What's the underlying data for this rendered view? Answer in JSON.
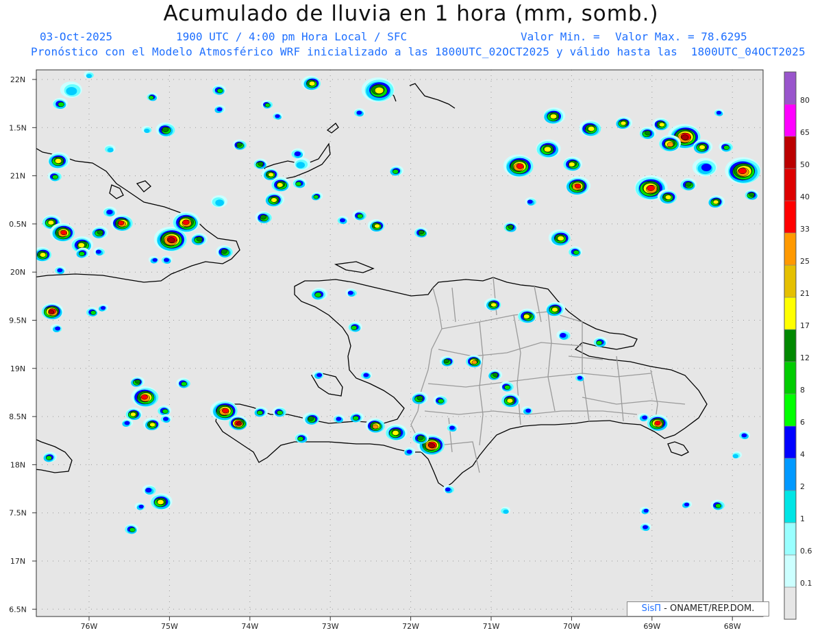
{
  "header": {
    "title": "Acumulado de lluvia en 1 hora (mm, somb.)",
    "date": "03-Oct-2025",
    "time": "1900 UTC / 4:00 pm Hora Local / SFC",
    "min_label": "Valor Min. =",
    "max_label": "Valor Max. = 78.6295",
    "model_info": "Pronóstico con el Modelo Atmosférico WRF inicializado a las 1800UTC_02OCT2025 y válido hasta las  1800UTC_04OCT2025"
  },
  "axes": {
    "lat_labels": [
      "22N",
      "1.5N",
      "21N",
      "0.5N",
      "20N",
      "9.5N",
      "19N",
      "8.5N",
      "18N",
      "7.5N",
      "17N",
      "6.5N"
    ],
    "lon_labels": [
      "76W",
      "75W",
      "74W",
      "73W",
      "72W",
      "71W",
      "70W",
      "69W",
      "68W"
    ]
  },
  "colorbar": {
    "levels": [
      "0.1",
      "0.6",
      "1",
      "2",
      "4",
      "6",
      "8",
      "12",
      "17",
      "21",
      "25",
      "33",
      "40",
      "50",
      "65",
      "80"
    ],
    "colors": [
      "#e6e6e6",
      "#ccffff",
      "#99ffff",
      "#00e5e5",
      "#0099ff",
      "#0000ff",
      "#00ff00",
      "#00cc00",
      "#008800",
      "#ffff00",
      "#e5c000",
      "#ff9900",
      "#ff0000",
      "#dd0000",
      "#bb0000",
      "#ff00ff",
      "#9955cc"
    ]
  },
  "credit": {
    "brand": "SisΠ",
    "text": " - ONAMET/REP.DOM."
  }
}
